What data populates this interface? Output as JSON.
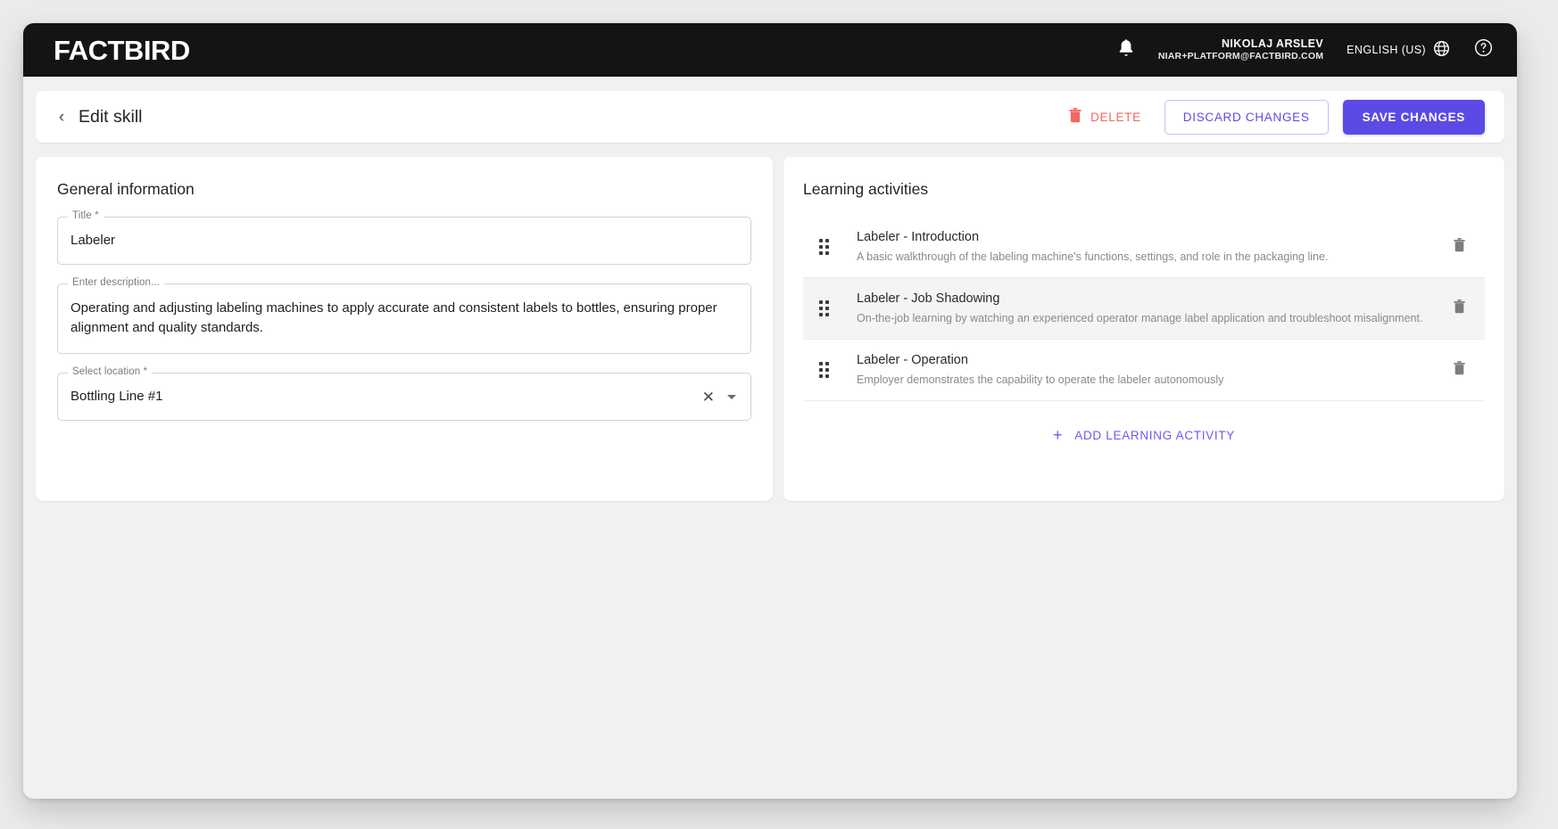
{
  "topbar": {
    "logo_text": "FACTBIRD",
    "notifications_icon": "bell-icon",
    "user_name": "NIKOLAJ ARSLEV",
    "user_email": "NIAR+PLATFORM@FACTBIRD.COM",
    "language_label": "ENGLISH (US)",
    "language_icon": "globe-icon",
    "help_icon": "help-circle-icon"
  },
  "page_header": {
    "back_icon": "chevron-left-icon",
    "title": "Edit skill",
    "delete_label": "DELETE",
    "delete_icon": "trash-icon",
    "discard_label": "DISCARD CHANGES",
    "save_label": "SAVE CHANGES"
  },
  "general_information": {
    "section_title": "General information",
    "title_field": {
      "label": "Title *",
      "value": "Labeler",
      "placeholder": "Title"
    },
    "description_field": {
      "label": "Enter description...",
      "value": "Operating and adjusting labeling machines to apply accurate and consistent labels to bottles, ensuring proper alignment and quality standards.",
      "placeholder": "Enter description..."
    },
    "location_field": {
      "label": "Select location *",
      "value": "Bottling Line #1",
      "placeholder": "Select location",
      "clear_icon": "close-icon",
      "dropdown_icon": "chevron-down-icon"
    }
  },
  "learning_activities": {
    "section_title": "Learning activities",
    "add_label": "ADD LEARNING ACTIVITY",
    "add_icon": "plus-icon",
    "drag_icon": "drag-handle-icon",
    "delete_icon": "trash-icon",
    "items": [
      {
        "title": "Labeler - Introduction",
        "description": "A basic walkthrough of the labeling machine's functions, settings, and role in the packaging line.",
        "hovered": false
      },
      {
        "title": "Labeler - Job Shadowing",
        "description": "On-the-job learning by watching an experienced operator manage label application and troubleshoot misalignment.",
        "hovered": true
      },
      {
        "title": "Labeler - Operation",
        "description": "Employer demonstrates the capability to operate the labeler autonomously",
        "hovered": false
      }
    ]
  },
  "colors": {
    "accent_purple": "#5b4ae6",
    "delete_red": "#f2675f",
    "topbar_black": "#141414",
    "app_background": "#f1f1f1",
    "card_white": "#ffffff",
    "row_hover": "#f4f4f4"
  }
}
